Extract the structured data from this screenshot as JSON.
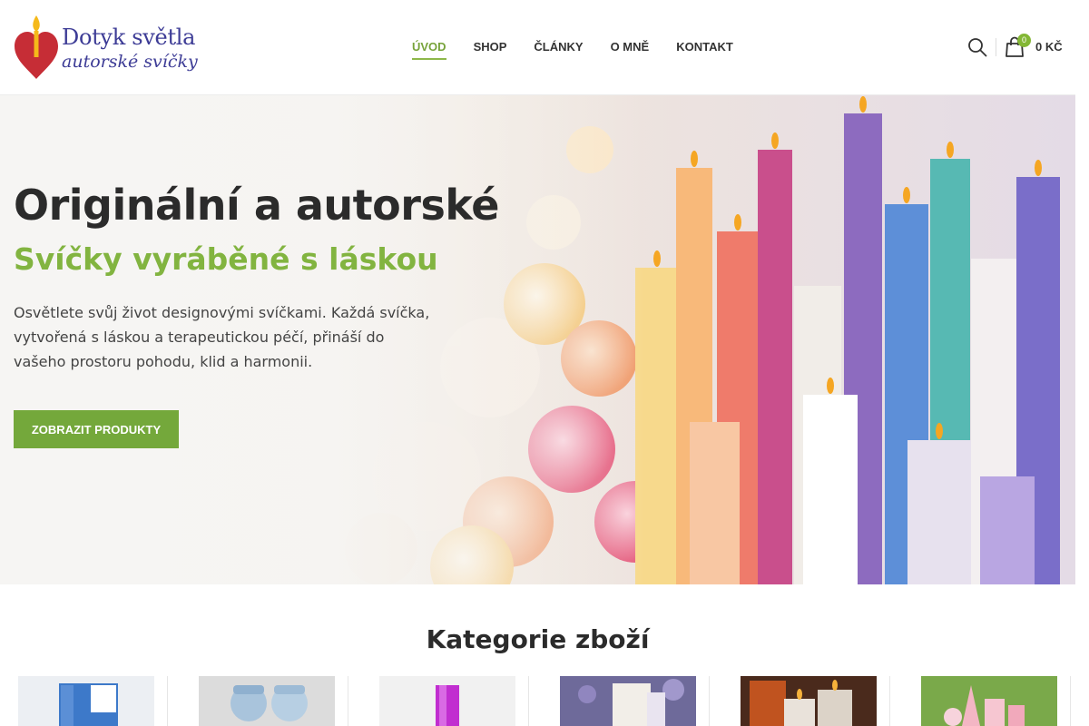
{
  "brand": {
    "title": "Dotyk světla",
    "subtitle": "autorské svíčky",
    "colors": {
      "primary": "#3d3c96",
      "heart": "#c62d36",
      "flame": "#f5b91a"
    }
  },
  "nav": {
    "items": [
      {
        "label": "ÚVOD",
        "active": true
      },
      {
        "label": "SHOP"
      },
      {
        "label": "ČLÁNKY"
      },
      {
        "label": "O MNĚ"
      },
      {
        "label": "KONTAKT"
      }
    ]
  },
  "header": {
    "search_icon": "search-icon",
    "cart_icon": "shopping-bag-icon",
    "cart_count": "0",
    "cart_total": "0 KČ"
  },
  "hero": {
    "title": "Originální a autorské",
    "subtitle": "Svíčky vyráběné s láskou",
    "text": "Osvětlete svůj život designovými svíčkami. Každá svíčka, vytvořená s láskou a terapeutickou péčí, přináší do vašeho prostoru pohodu, klid a harmonii.",
    "button": "ZOBRAZIT PRODUKTY"
  },
  "categories": {
    "title": "Kategorie zboží"
  },
  "colors": {
    "accent": "#83b735",
    "button": "#74a83b",
    "text": "#2b2b2b"
  }
}
